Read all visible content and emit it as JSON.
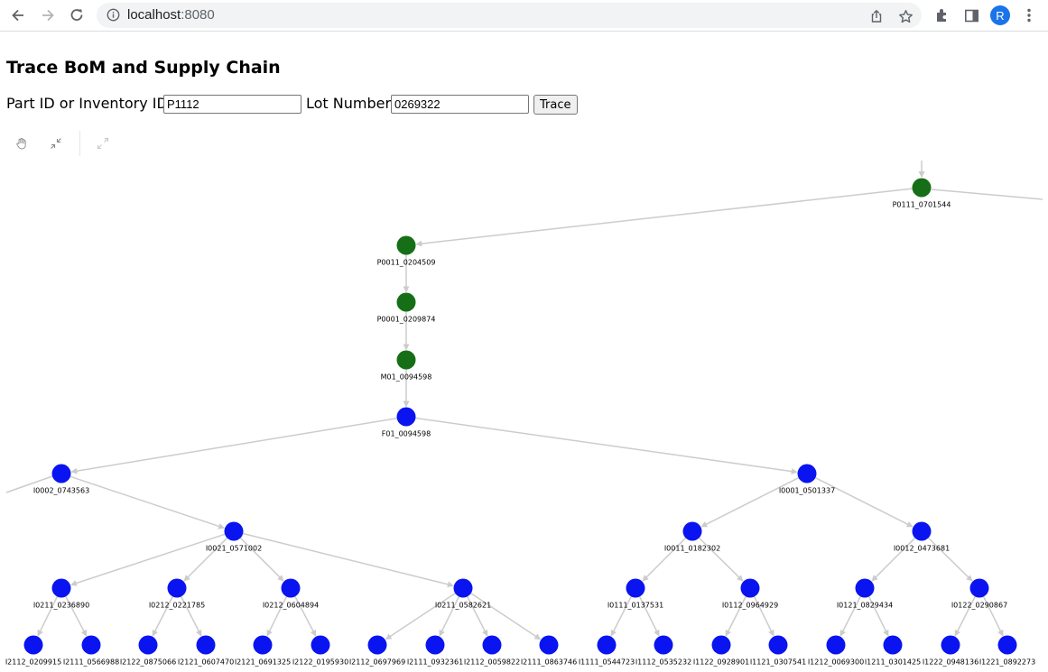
{
  "browser": {
    "url_host": "localhost",
    "url_port": ":8080",
    "profile_initial": "R"
  },
  "page": {
    "title": "Trace BoM and Supply Chain"
  },
  "form": {
    "part_label": "Part ID or Inventory ID:",
    "part_value": "P1112",
    "lot_label": "Lot Number:",
    "lot_value": "0269322",
    "trace_button": "Trace"
  },
  "colors": {
    "product_node": "#166f16",
    "inventory_node": "#0a14f0",
    "edge": "#cccccc"
  },
  "graph": {
    "nodes": [
      {
        "id": "P0111_0701544",
        "type": "product"
      },
      {
        "id": "P0011_0204509",
        "type": "product"
      },
      {
        "id": "P0001_0209874",
        "type": "product"
      },
      {
        "id": "M01_0094598",
        "type": "product"
      },
      {
        "id": "F01_0094598",
        "type": "inventory"
      },
      {
        "id": "I0002_0743563",
        "type": "inventory"
      },
      {
        "id": "I0001_0501337",
        "type": "inventory"
      },
      {
        "id": "I0021_0571002",
        "type": "inventory"
      },
      {
        "id": "I0011_0182302",
        "type": "inventory"
      },
      {
        "id": "I0012_0473681",
        "type": "inventory"
      },
      {
        "id": "I0211_0236890",
        "type": "inventory"
      },
      {
        "id": "I0212_0221785",
        "type": "inventory"
      },
      {
        "id": "I0212_0604894",
        "type": "inventory"
      },
      {
        "id": "I0211_0582621",
        "type": "inventory"
      },
      {
        "id": "I0111_0137531",
        "type": "inventory"
      },
      {
        "id": "I0112_0964929",
        "type": "inventory"
      },
      {
        "id": "I0121_0829434",
        "type": "inventory"
      },
      {
        "id": "I0122_0290867",
        "type": "inventory"
      },
      {
        "id": "I2112_0209915",
        "type": "inventory"
      },
      {
        "id": "I2111_0566988",
        "type": "inventory"
      },
      {
        "id": "I2122_0875066",
        "type": "inventory"
      },
      {
        "id": "I2121_0607470",
        "type": "inventory"
      },
      {
        "id": "I2121_0691325",
        "type": "inventory"
      },
      {
        "id": "I2122_0195930",
        "type": "inventory"
      },
      {
        "id": "I2112_0697969",
        "type": "inventory"
      },
      {
        "id": "I2111_0932361",
        "type": "inventory"
      },
      {
        "id": "I2112_0059822",
        "type": "inventory"
      },
      {
        "id": "I2111_0863746",
        "type": "inventory"
      },
      {
        "id": "I1111_0544723",
        "type": "inventory"
      },
      {
        "id": "I1112_0535232",
        "type": "inventory"
      },
      {
        "id": "I1122_0928901",
        "type": "inventory"
      },
      {
        "id": "I1121_0307541",
        "type": "inventory"
      },
      {
        "id": "I1212_0069300",
        "type": "inventory"
      },
      {
        "id": "I1211_0301425",
        "type": "inventory"
      },
      {
        "id": "I1222_0948136",
        "type": "inventory"
      },
      {
        "id": "I1221_0892273",
        "type": "inventory"
      }
    ],
    "edges": [
      [
        "P0111_0701544",
        "P0011_0204509"
      ],
      [
        "P0011_0204509",
        "P0001_0209874"
      ],
      [
        "P0001_0209874",
        "M01_0094598"
      ],
      [
        "M01_0094598",
        "F01_0094598"
      ],
      [
        "F01_0094598",
        "I0002_0743563"
      ],
      [
        "F01_0094598",
        "I0001_0501337"
      ],
      [
        "I0002_0743563",
        "I0021_0571002"
      ],
      [
        "I0001_0501337",
        "I0011_0182302"
      ],
      [
        "I0001_0501337",
        "I0012_0473681"
      ],
      [
        "I0021_0571002",
        "I0211_0236890"
      ],
      [
        "I0021_0571002",
        "I0212_0221785"
      ],
      [
        "I0021_0571002",
        "I0212_0604894"
      ],
      [
        "I0021_0571002",
        "I0211_0582621"
      ],
      [
        "I0011_0182302",
        "I0111_0137531"
      ],
      [
        "I0011_0182302",
        "I0112_0964929"
      ],
      [
        "I0012_0473681",
        "I0121_0829434"
      ],
      [
        "I0012_0473681",
        "I0122_0290867"
      ],
      [
        "I0211_0236890",
        "I2112_0209915"
      ],
      [
        "I0211_0236890",
        "I2111_0566988"
      ],
      [
        "I0212_0221785",
        "I2122_0875066"
      ],
      [
        "I0212_0221785",
        "I2121_0607470"
      ],
      [
        "I0212_0604894",
        "I2121_0691325"
      ],
      [
        "I0212_0604894",
        "I2122_0195930"
      ],
      [
        "I0211_0582621",
        "I2112_0697969"
      ],
      [
        "I0211_0582621",
        "I2111_0932361"
      ],
      [
        "I0211_0582621",
        "I2112_0059822"
      ],
      [
        "I0211_0582621",
        "I2111_0863746"
      ],
      [
        "I0111_0137531",
        "I1111_0544723"
      ],
      [
        "I0111_0137531",
        "I1112_0535232"
      ],
      [
        "I0112_0964929",
        "I1122_0928901"
      ],
      [
        "I0112_0964929",
        "I1121_0307541"
      ],
      [
        "I0121_0829434",
        "I1212_0069300"
      ],
      [
        "I0121_0829434",
        "I1211_0301425"
      ],
      [
        "I0122_0290867",
        "I1222_0948136"
      ],
      [
        "I0122_0290867",
        "I1221_0892273"
      ]
    ]
  }
}
